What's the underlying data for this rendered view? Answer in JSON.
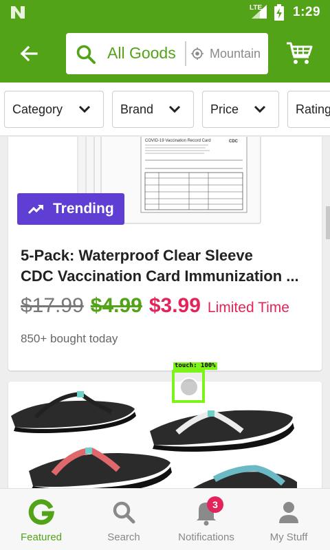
{
  "status_bar": {
    "network": "LTE",
    "time": "1:29"
  },
  "search": {
    "query": "All Goods",
    "location": "Mountain"
  },
  "filters": [
    {
      "label": "Category"
    },
    {
      "label": "Brand"
    },
    {
      "label": "Price"
    },
    {
      "label": "Rating"
    }
  ],
  "deal": {
    "badge": "Trending",
    "title_line1": "5-Pack: Waterproof Clear Sleeve",
    "title_line2": "CDC Vaccination Card Immunization ...",
    "price_original": "$17.99",
    "price_sale": "$4.99",
    "price_final": "$3.99",
    "promo": "Limited Time",
    "social_proof": "850+ bought today",
    "image_heading": "COVID-19 Vaccination Record Card",
    "image_logo": "CDC"
  },
  "touch_indicator": {
    "label": "touch: 100%"
  },
  "bottom_nav": {
    "featured": "Featured",
    "search": "Search",
    "notifications": "Notifications",
    "notifications_badge": "3",
    "my_stuff": "My Stuff"
  },
  "colors": {
    "brand_green": "#53a318",
    "accent_pink": "#e2245b",
    "trending_purple": "#5f3fd3"
  }
}
